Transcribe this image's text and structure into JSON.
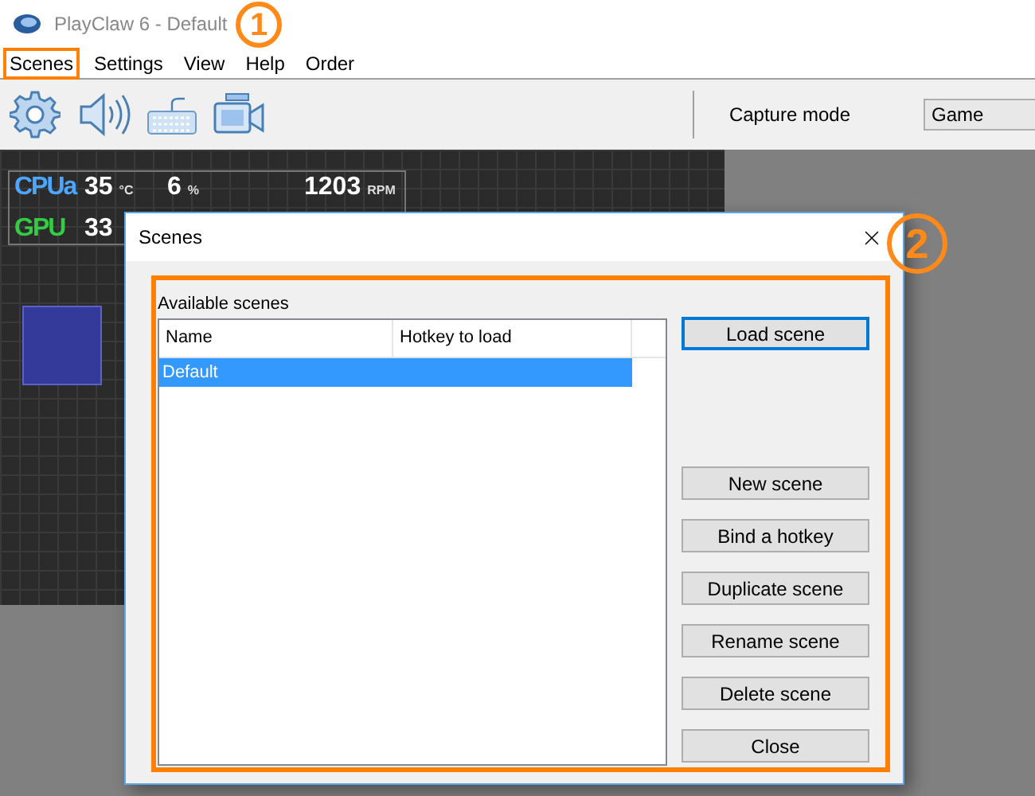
{
  "window": {
    "title": "PlayClaw 6 - Default"
  },
  "menu": [
    {
      "label": "Scenes",
      "marked": true
    },
    {
      "label": "Settings",
      "marked": false
    },
    {
      "label": "View",
      "marked": false
    },
    {
      "label": "Help",
      "marked": false
    },
    {
      "label": "Order",
      "marked": false
    }
  ],
  "capture_mode": {
    "label": "Capture mode",
    "value": "Game"
  },
  "overlay": {
    "rows": [
      {
        "name": "CPUa",
        "color": "#4da6ff",
        "readings": [
          {
            "value": "35",
            "unit": "°C"
          },
          {
            "value": "6",
            "unit": "%"
          },
          {
            "value": "1203",
            "unit": "RPM"
          }
        ]
      },
      {
        "name": "GPU",
        "color": "#33cc44",
        "readings": [
          {
            "value": "33"
          }
        ]
      }
    ]
  },
  "dialog": {
    "title": "Scenes",
    "group_label": "Available scenes",
    "columns": [
      "Name",
      "Hotkey to load"
    ],
    "rows": [
      {
        "cells": [
          "Default"
        ],
        "selected": true
      }
    ],
    "top_buttons": [
      {
        "label": "Load scene",
        "default": true
      }
    ],
    "buttons": [
      {
        "label": "New scene",
        "default": false
      },
      {
        "label": "Bind a hotkey",
        "default": false
      },
      {
        "label": "Duplicate scene",
        "default": false
      },
      {
        "label": "Rename scene",
        "default": false
      },
      {
        "label": "Delete scene",
        "default": false
      },
      {
        "label": "Close",
        "default": false
      }
    ]
  },
  "annotations": [
    {
      "label": "1"
    },
    {
      "label": "2"
    }
  ]
}
